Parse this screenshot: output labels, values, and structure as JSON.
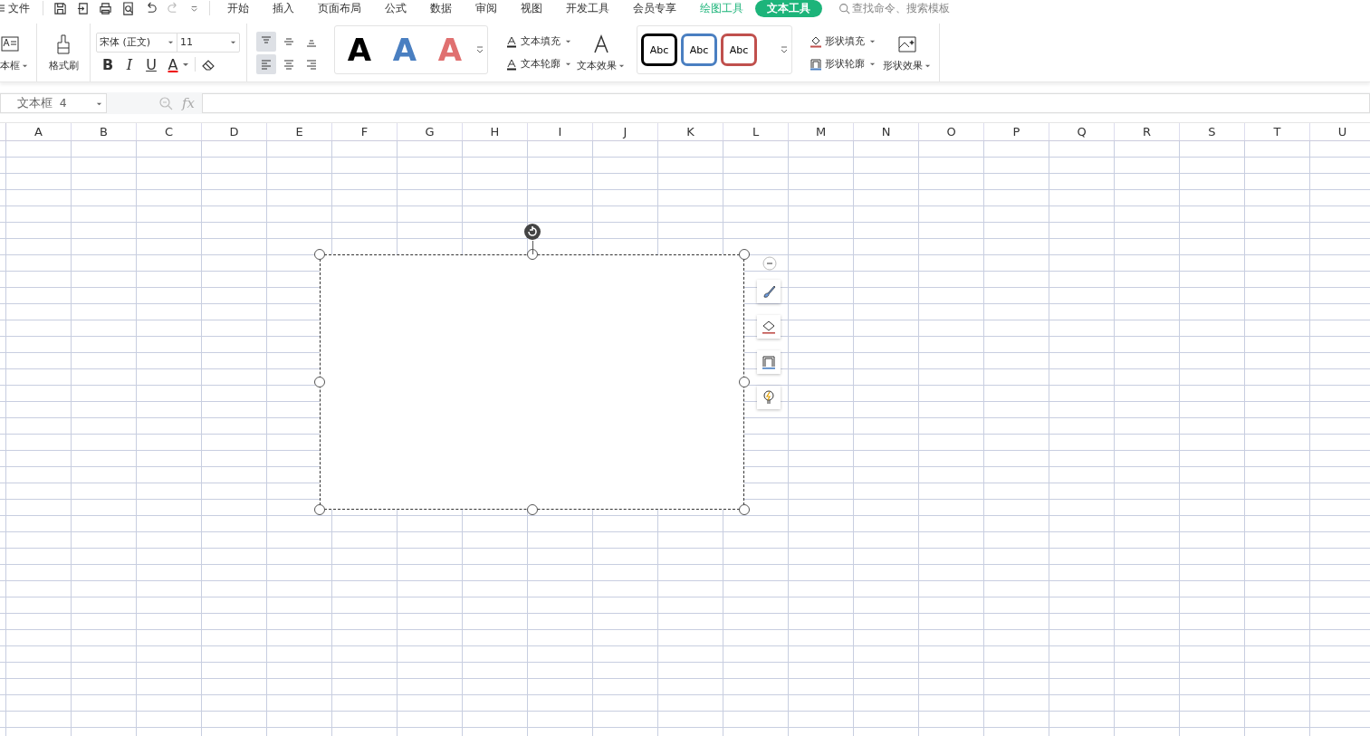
{
  "menu": {
    "file": "文件",
    "tabs": [
      {
        "label": "开始",
        "kind": "normal",
        "selected": false
      },
      {
        "label": "插入",
        "kind": "normal",
        "selected": false
      },
      {
        "label": "页面布局",
        "kind": "normal",
        "selected": false
      },
      {
        "label": "公式",
        "kind": "normal",
        "selected": false
      },
      {
        "label": "数据",
        "kind": "normal",
        "selected": false
      },
      {
        "label": "审阅",
        "kind": "normal",
        "selected": false
      },
      {
        "label": "视图",
        "kind": "normal",
        "selected": false
      },
      {
        "label": "开发工具",
        "kind": "normal",
        "selected": false
      },
      {
        "label": "会员专享",
        "kind": "normal",
        "selected": false
      },
      {
        "label": "绘图工具",
        "kind": "context",
        "selected": false
      },
      {
        "label": "文本工具",
        "kind": "context",
        "selected": true
      }
    ],
    "search": {
      "placeholder": "查找命令、搜索模板"
    }
  },
  "ribbon": {
    "text_box": "本框",
    "format_painter": "格式刷",
    "font": "宋体 (正文)",
    "font_size": "11",
    "bold": "B",
    "italic": "I",
    "underline": "U",
    "font_color": "A",
    "align": [
      {
        "selected": true
      },
      {
        "selected": false
      },
      {
        "selected": false
      },
      {
        "selected": true
      },
      {
        "selected": false
      },
      {
        "selected": false
      }
    ],
    "text_styles": [
      {
        "label": "A",
        "color": "#000000"
      },
      {
        "label": "A",
        "color": "#4a7fc1"
      },
      {
        "label": "A",
        "color": "#e07070"
      }
    ],
    "text_fill": "文本填充",
    "text_outline": "文本轮廓",
    "text_effect": "文本效果",
    "shape_styles": [
      {
        "label": "Abc",
        "color": "#000000"
      },
      {
        "label": "Abc",
        "color": "#4a7fc1"
      },
      {
        "label": "Abc",
        "color": "#c0504d"
      }
    ],
    "shape_fill": "形状填充",
    "shape_outline": "形状轮廓",
    "shape_effect": "形状效果"
  },
  "formula_bar": {
    "name_box": "文本框 4",
    "fx": "fx"
  },
  "sheet": {
    "columns": [
      "A",
      "B",
      "C",
      "D",
      "E",
      "F",
      "G",
      "H",
      "I",
      "J",
      "K",
      "L",
      "M",
      "N",
      "O",
      "P",
      "Q",
      "R",
      "S",
      "T",
      "U"
    ]
  }
}
